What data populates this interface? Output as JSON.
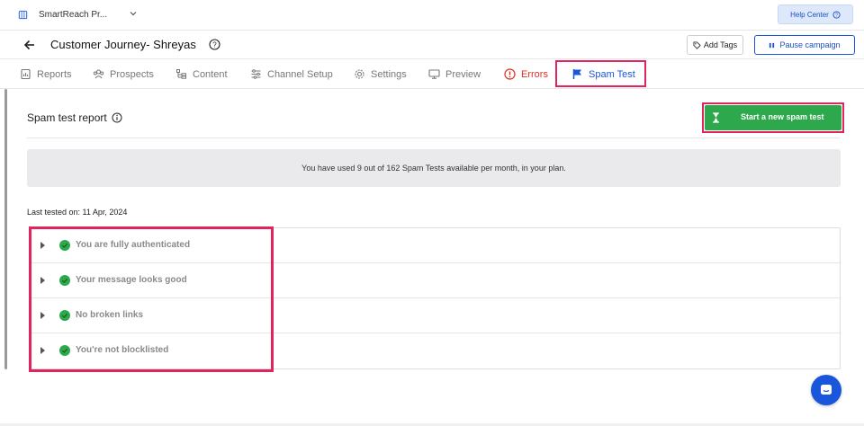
{
  "topbar": {
    "workspace_name": "SmartReach Pr...",
    "help_label": "Help Center"
  },
  "header": {
    "title": "Customer Journey- Shreyas",
    "add_tags_label": "Add Tags",
    "pause_label": "Pause campaign"
  },
  "tabs": [
    {
      "label": "Reports",
      "icon": "reports-icon"
    },
    {
      "label": "Prospects",
      "icon": "prospects-icon"
    },
    {
      "label": "Content",
      "icon": "content-icon"
    },
    {
      "label": "Channel Setup",
      "icon": "channel-setup-icon"
    },
    {
      "label": "Settings",
      "icon": "gear-icon"
    },
    {
      "label": "Preview",
      "icon": "monitor-icon"
    },
    {
      "label": "Errors",
      "icon": "error-icon"
    },
    {
      "label": "Spam Test",
      "icon": "flag-icon",
      "active": true
    }
  ],
  "report": {
    "title": "Spam test report",
    "start_button": "Start a new spam test",
    "usage_text": "You have used 9 out of 162 Spam Tests available per month, in your plan.",
    "last_tested": "Last tested on: 11 Apr, 2024",
    "checks": [
      {
        "label": "You are fully authenticated",
        "status": "pass"
      },
      {
        "label": "Your message looks good",
        "status": "pass"
      },
      {
        "label": "No broken links",
        "status": "pass"
      },
      {
        "label": "You're not blocklisted",
        "status": "pass"
      }
    ]
  },
  "colors": {
    "accent": "#1a56db",
    "success": "#2ea84c",
    "error": "#d93025",
    "highlight": "#e0245e"
  }
}
